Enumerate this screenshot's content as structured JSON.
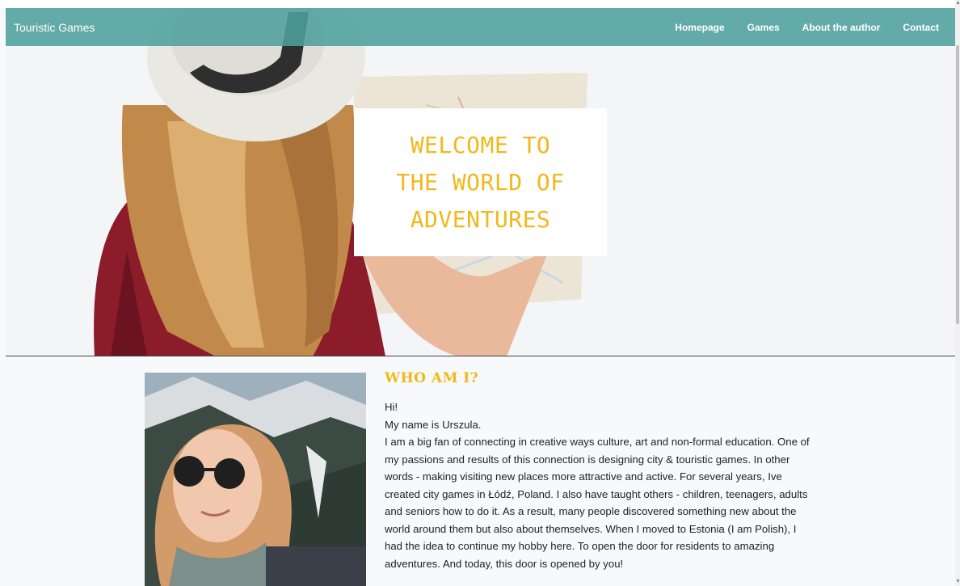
{
  "navbar": {
    "brand": "Touristic Games",
    "links": [
      "Homepage",
      "Games",
      "About the author",
      "Contact"
    ]
  },
  "hero": {
    "welcome_lines": [
      "WELCOME TO",
      "THE WORLD OF",
      "ADVENTURES"
    ]
  },
  "about": {
    "title": "WHO AM I?",
    "paragraphs": [
      "Hi!",
      "My name is Urszula.",
      "I am a big fan of connecting in creative ways culture, art and non-formal education. One of my passions and results of this connection is designing city & touristic games. In other words - making visiting new places more attractive and active. For several years, Ive created city games in Łódź, Poland. I also have taught others - children, teenagers, adults and seniors how to do it. As a result, many people discovered something new about the world around them but also about themselves. When I moved to Estonia (I am Polish), I had the idea to continue my hobby here. To open the door for residents to amazing adventures. And today, this door is opened by you!"
    ]
  },
  "colors": {
    "navbar": "#4ea09e",
    "accent": "#f1b81b",
    "background": "#f8f9fa"
  }
}
